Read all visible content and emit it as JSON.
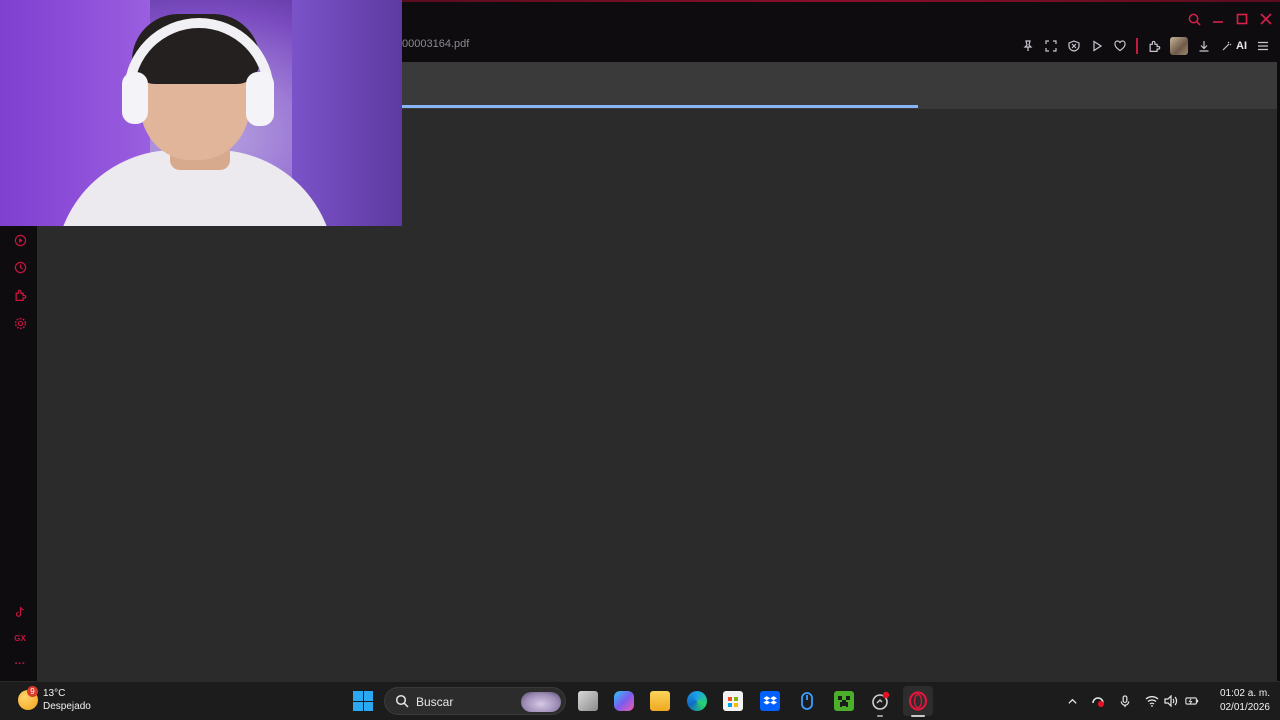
{
  "browser": {
    "address_text": "00003164.pdf",
    "ai_label": "AI",
    "accent_color": "#c8143f"
  },
  "pdf_viewer": {
    "loading_progress_percent": 59
  },
  "sidebar": {
    "items": [
      {
        "icon": "player-icon"
      },
      {
        "icon": "history-icon"
      },
      {
        "icon": "extensions-icon"
      },
      {
        "icon": "settings-icon"
      }
    ],
    "bottom_items": [
      {
        "icon": "tiktok-icon"
      },
      {
        "icon": "gx-icon",
        "label": "GX"
      },
      {
        "icon": "more-icon",
        "label": "···"
      }
    ]
  },
  "webcam": {
    "description_icon": "webcam-feed"
  },
  "taskbar": {
    "weather": {
      "badge": "9",
      "temp": "13°C",
      "desc": "Despejado"
    },
    "search_placeholder": "Buscar",
    "apps": [
      {
        "name": "task-view"
      },
      {
        "name": "copilot"
      },
      {
        "name": "file-explorer"
      },
      {
        "name": "edge"
      },
      {
        "name": "microsoft-store"
      },
      {
        "name": "dropbox"
      },
      {
        "name": "mouse-app"
      },
      {
        "name": "minecraft"
      },
      {
        "name": "steam-like"
      },
      {
        "name": "opera-gx"
      }
    ],
    "clock": {
      "time": "01:02 a. m.",
      "date": "02/01/2026"
    }
  }
}
